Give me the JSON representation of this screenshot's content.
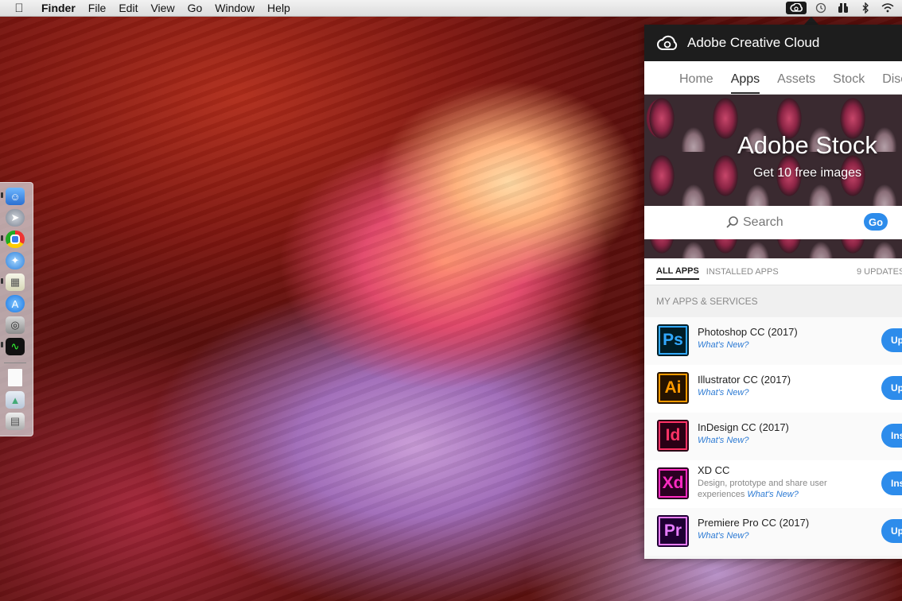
{
  "menubar": {
    "app_name": "Finder",
    "items": [
      "File",
      "Edit",
      "View",
      "Go",
      "Window",
      "Help"
    ]
  },
  "dock": {
    "icons": [
      "finder-icon",
      "launchpad-icon",
      "chrome-icon",
      "safari-icon",
      "preview-icon",
      "app-store-icon",
      "screenshot-icon",
      "activity-monitor-icon",
      "document-icon",
      "image-icon",
      "trash-icon"
    ]
  },
  "cc": {
    "title": "Adobe Creative Cloud",
    "tabs": [
      "Home",
      "Apps",
      "Assets",
      "Stock",
      "Disc"
    ],
    "active_tab": "Apps",
    "banner": {
      "title": "Adobe Stock",
      "subtitle": "Get 10 free images"
    },
    "search": {
      "placeholder": "Search",
      "go_label": "Go"
    },
    "filters": {
      "all": "ALL APPS",
      "installed": "INSTALLED APPS",
      "updates": "9 UPDATES"
    },
    "section_label": "MY APPS & SERVICES",
    "apps": [
      {
        "abbr": "Ps",
        "name": "Photoshop CC (2017)",
        "link": "What's New?",
        "action": "Up",
        "bg": "#001d26",
        "fg": "#31a8ff"
      },
      {
        "abbr": "Ai",
        "name": "Illustrator CC (2017)",
        "link": "What's New?",
        "action": "Up",
        "bg": "#261300",
        "fg": "#ff9a00"
      },
      {
        "abbr": "Id",
        "name": "InDesign CC (2017)",
        "link": "What's New?",
        "action": "Ins",
        "bg": "#2a0015",
        "fg": "#ff3366"
      },
      {
        "abbr": "Xd",
        "name": "XD CC",
        "desc": "Design, prototype and share user experiences",
        "link": "What's New?",
        "action": "Ins",
        "bg": "#2b0022",
        "fg": "#ff2bc2"
      },
      {
        "abbr": "Pr",
        "name": "Premiere Pro CC (2017)",
        "link": "What's New?",
        "action": "Up",
        "bg": "#1f0033",
        "fg": "#e77cff"
      }
    ]
  },
  "colors": {
    "accent": "#2d8ceb",
    "header_bg": "#1d1d1d"
  }
}
